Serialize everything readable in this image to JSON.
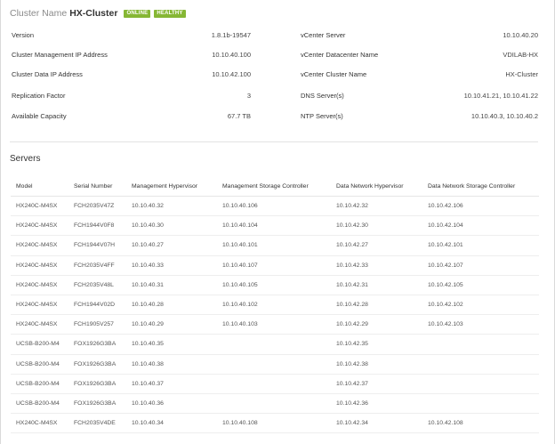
{
  "cluster": {
    "label": "Cluster Name",
    "name": "HX-Cluster",
    "status_badges": [
      "ONLINE",
      "HEALTHY"
    ],
    "badge_color": "#86b735"
  },
  "summary": {
    "left": [
      {
        "key": "Version",
        "value": "1.8.1b-19547"
      },
      {
        "key": "Cluster Management IP Address",
        "value": "10.10.40.100"
      },
      {
        "key": "Cluster Data IP Address",
        "value": "10.10.42.100"
      },
      {
        "key": "Replication Factor",
        "value": "3"
      },
      {
        "key": "Available Capacity",
        "value": "67.7 TB"
      }
    ],
    "right": [
      {
        "key": "vCenter Server",
        "value": "10.10.40.20"
      },
      {
        "key": "vCenter Datacenter Name",
        "value": "VDILAB-HX"
      },
      {
        "key": "vCenter Cluster Name",
        "value": "HX-Cluster"
      },
      {
        "key": "DNS Server(s)",
        "value": "10.10.41.21, 10.10.41.22"
      },
      {
        "key": "NTP Server(s)",
        "value": "10.10.40.3, 10.10.40.2"
      }
    ]
  },
  "servers": {
    "title": "Servers",
    "columns": [
      "Model",
      "Serial Number",
      "Management Hypervisor",
      "Management Storage Controller",
      "Data Network Hypervisor",
      "Data Network Storage Controller"
    ],
    "rows": [
      [
        "HX240C-M4SX",
        "FCH2035V47Z",
        "10.10.40.32",
        "10.10.40.106",
        "10.10.42.32",
        "10.10.42.106"
      ],
      [
        "HX240C-M4SX",
        "FCH1944V0F8",
        "10.10.40.30",
        "10.10.40.104",
        "10.10.42.30",
        "10.10.42.104"
      ],
      [
        "HX240C-M4SX",
        "FCH1944V07H",
        "10.10.40.27",
        "10.10.40.101",
        "10.10.42.27",
        "10.10.42.101"
      ],
      [
        "HX240C-M4SX",
        "FCH2035V4FF",
        "10.10.40.33",
        "10.10.40.107",
        "10.10.42.33",
        "10.10.42.107"
      ],
      [
        "HX240C-M4SX",
        "FCH2035V48L",
        "10.10.40.31",
        "10.10.40.105",
        "10.10.42.31",
        "10.10.42.105"
      ],
      [
        "HX240C-M4SX",
        "FCH1944V02D",
        "10.10.40.28",
        "10.10.40.102",
        "10.10.42.28",
        "10.10.42.102"
      ],
      [
        "HX240C-M4SX",
        "FCH1905V257",
        "10.10.40.29",
        "10.10.40.103",
        "10.10.42.29",
        "10.10.42.103"
      ],
      [
        "UCSB-B200-M4",
        "FOX1926G3BA",
        "10.10.40.35",
        "",
        "10.10.42.35",
        ""
      ],
      [
        "UCSB-B200-M4",
        "FOX1926G3BA",
        "10.10.40.38",
        "",
        "10.10.42.38",
        ""
      ],
      [
        "UCSB-B200-M4",
        "FOX1926G3BA",
        "10.10.40.37",
        "",
        "10.10.42.37",
        ""
      ],
      [
        "UCSB-B200-M4",
        "FOX1926G3BA",
        "10.10.40.36",
        "",
        "10.10.42.36",
        ""
      ],
      [
        "HX240C-M4SX",
        "FCH2035V4DE",
        "10.10.40.34",
        "10.10.40.108",
        "10.10.42.34",
        "10.10.42.108"
      ]
    ]
  }
}
